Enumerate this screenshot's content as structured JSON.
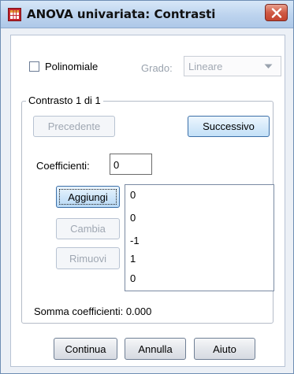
{
  "window": {
    "title": "ANOVA univariata: Contrasti"
  },
  "polynomial": {
    "checkbox_label": "Polinomiale",
    "checked": false,
    "degree_label": "Grado:",
    "degree_value": "Lineare"
  },
  "contrast_group": {
    "title": "Contrasto 1 di 1",
    "previous_label": "Precedente",
    "next_label": "Successivo",
    "coefficients_label": "Coefficienti:",
    "coefficient_value": "0",
    "add_label": "Aggiungi",
    "change_label": "Cambia",
    "remove_label": "Rimuovi",
    "coefficients_list": [
      "0",
      "0",
      "-1",
      "1",
      "0"
    ],
    "sum_label": "Somma coefficienti:",
    "sum_value": "0.000"
  },
  "footer": {
    "continue_label": "Continua",
    "cancel_label": "Annulla",
    "help_label": "Aiuto"
  },
  "colors": {
    "titlebar": "#bcd3ee",
    "dialog_bg": "#ecf0f6",
    "close_button": "#d05a45",
    "focus_button": "#cfe6f9"
  },
  "icons": {
    "app": "spss-table-icon",
    "close": "close-icon",
    "dropdown": "chevron-down-icon"
  }
}
